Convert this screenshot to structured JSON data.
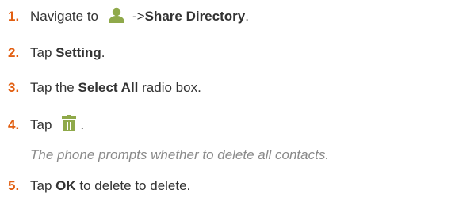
{
  "steps": [
    {
      "num": "1.",
      "pre": "Navigate to",
      "mid": "->",
      "bold": "Share Directory",
      "post": ".",
      "icon": "person-icon",
      "icon_color": "#8fa94a"
    },
    {
      "num": "2.",
      "pre": "Tap",
      "bold": "Setting",
      "post": "."
    },
    {
      "num": "3.",
      "pre": "Tap the",
      "bold": "Select All",
      "post": "radio box."
    },
    {
      "num": "4.",
      "pre": "Tap",
      "post": ".",
      "icon": "trash-icon",
      "icon_color": "#8fa94a"
    },
    {
      "num": "5.",
      "pre": "Tap",
      "bold": "OK",
      "post": "to delete to delete."
    }
  ],
  "note": "The phone prompts whether to delete all contacts.",
  "colors": {
    "step_number": "#e25e10",
    "text": "#333333",
    "note": "#8a8a8a",
    "icon": "#8fa94a"
  }
}
